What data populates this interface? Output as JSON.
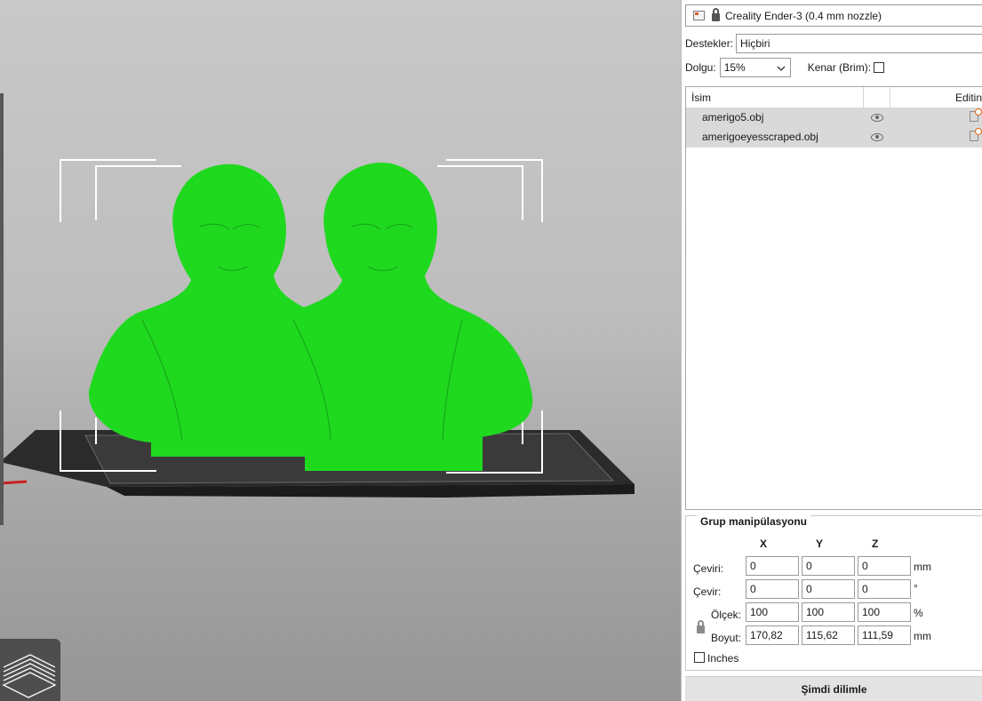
{
  "printer": {
    "name": "Creality Ender-3 (0.4 mm nozzle)"
  },
  "supports": {
    "label": "Destekler:",
    "value": "Hiçbiri"
  },
  "infill": {
    "label": "Dolgu:",
    "value": "15%",
    "brim_label": "Kenar (Brim):",
    "brim_checked": false
  },
  "object_list": {
    "columns": {
      "name": "İsim",
      "editing": "Editin"
    },
    "items": [
      {
        "name": "amerigo5.obj"
      },
      {
        "name": "amerigoeyesscraped.obj"
      }
    ]
  },
  "group_manipulation": {
    "title": "Grup manipülasyonu",
    "axes": [
      "X",
      "Y",
      "Z"
    ],
    "translate": {
      "label": "Çeviri:",
      "values": [
        "0",
        "0",
        "0"
      ],
      "unit": "mm"
    },
    "rotate": {
      "label": "Çevir:",
      "values": [
        "0",
        "0",
        "0"
      ],
      "unit": "°"
    },
    "scale": {
      "label": "Ölçek:",
      "values": [
        "100",
        "100",
        "100"
      ],
      "unit": "%"
    },
    "size": {
      "label": "Boyut:",
      "values": [
        "170,82",
        "115,62",
        "111,59"
      ],
      "unit": "mm"
    },
    "inches_label": "Inches",
    "inches_checked": false
  },
  "slice_button": {
    "label": "Şimdi dilimle"
  },
  "colors": {
    "model": "#1fd91f",
    "bed": "#2d2d2d",
    "accent": "#e06a1a"
  }
}
